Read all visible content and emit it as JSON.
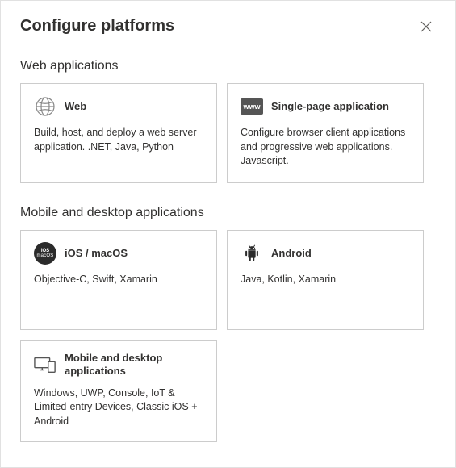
{
  "title": "Configure platforms",
  "sections": {
    "web": {
      "heading": "Web applications",
      "cards": {
        "web": {
          "title": "Web",
          "desc": "Build, host, and deploy a web server application. .NET, Java, Python"
        },
        "spa": {
          "title": "Single-page application",
          "desc": "Configure browser client applications and progressive web applications. Javascript."
        }
      }
    },
    "mobile": {
      "heading": "Mobile and desktop applications",
      "cards": {
        "ios": {
          "title": "iOS / macOS",
          "desc": "Objective-C, Swift, Xamarin"
        },
        "android": {
          "title": "Android",
          "desc": "Java, Kotlin, Xamarin"
        },
        "desktop": {
          "title": "Mobile and desktop applications",
          "desc": "Windows, UWP, Console, IoT & Limited-entry Devices, Classic iOS + Android"
        }
      }
    }
  },
  "icons": {
    "ios_line1": "iOS",
    "ios_line2": "macOS",
    "www": "www"
  }
}
